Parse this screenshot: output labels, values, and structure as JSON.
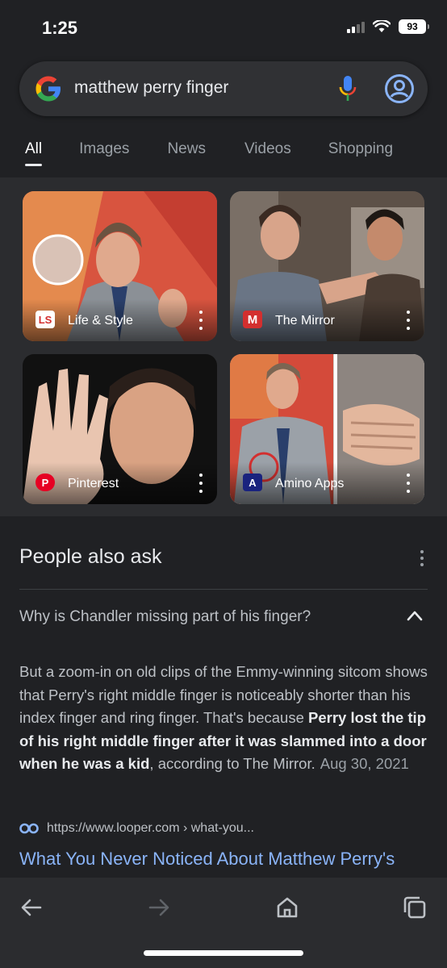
{
  "status": {
    "time": "1:25",
    "battery": "93"
  },
  "search": {
    "query": "matthew perry finger"
  },
  "tabs": [
    {
      "label": "All",
      "active": true
    },
    {
      "label": "Images"
    },
    {
      "label": "News"
    },
    {
      "label": "Videos"
    },
    {
      "label": "Shopping"
    }
  ],
  "image_results": [
    {
      "source": "Life & Style",
      "logo": "LS"
    },
    {
      "source": "The Mirror",
      "logo": "M"
    },
    {
      "source": "Pinterest",
      "logo": "P"
    },
    {
      "source": "Amino Apps",
      "logo": "A"
    }
  ],
  "people_also_ask": {
    "title": "People also ask",
    "question": "Why is Chandler missing part of his finger?",
    "answer_intro": "But a zoom-in on old clips of the Emmy-winning sitcom shows that Perry's right middle finger is noticeably shorter than his index finger and ring finger. That's because ",
    "answer_bold": "Perry lost the tip of his right middle finger after it was slammed into a door when he was a kid",
    "answer_outro": ", according to The Mirror.",
    "date": "Aug 30, 2021",
    "source_url": "https://www.looper.com › what-you...",
    "result_title": "What You Never Noticed About Matthew Perry's"
  },
  "colors": {
    "background": "#202124",
    "link": "#8ab4f8",
    "card": "#303134"
  }
}
